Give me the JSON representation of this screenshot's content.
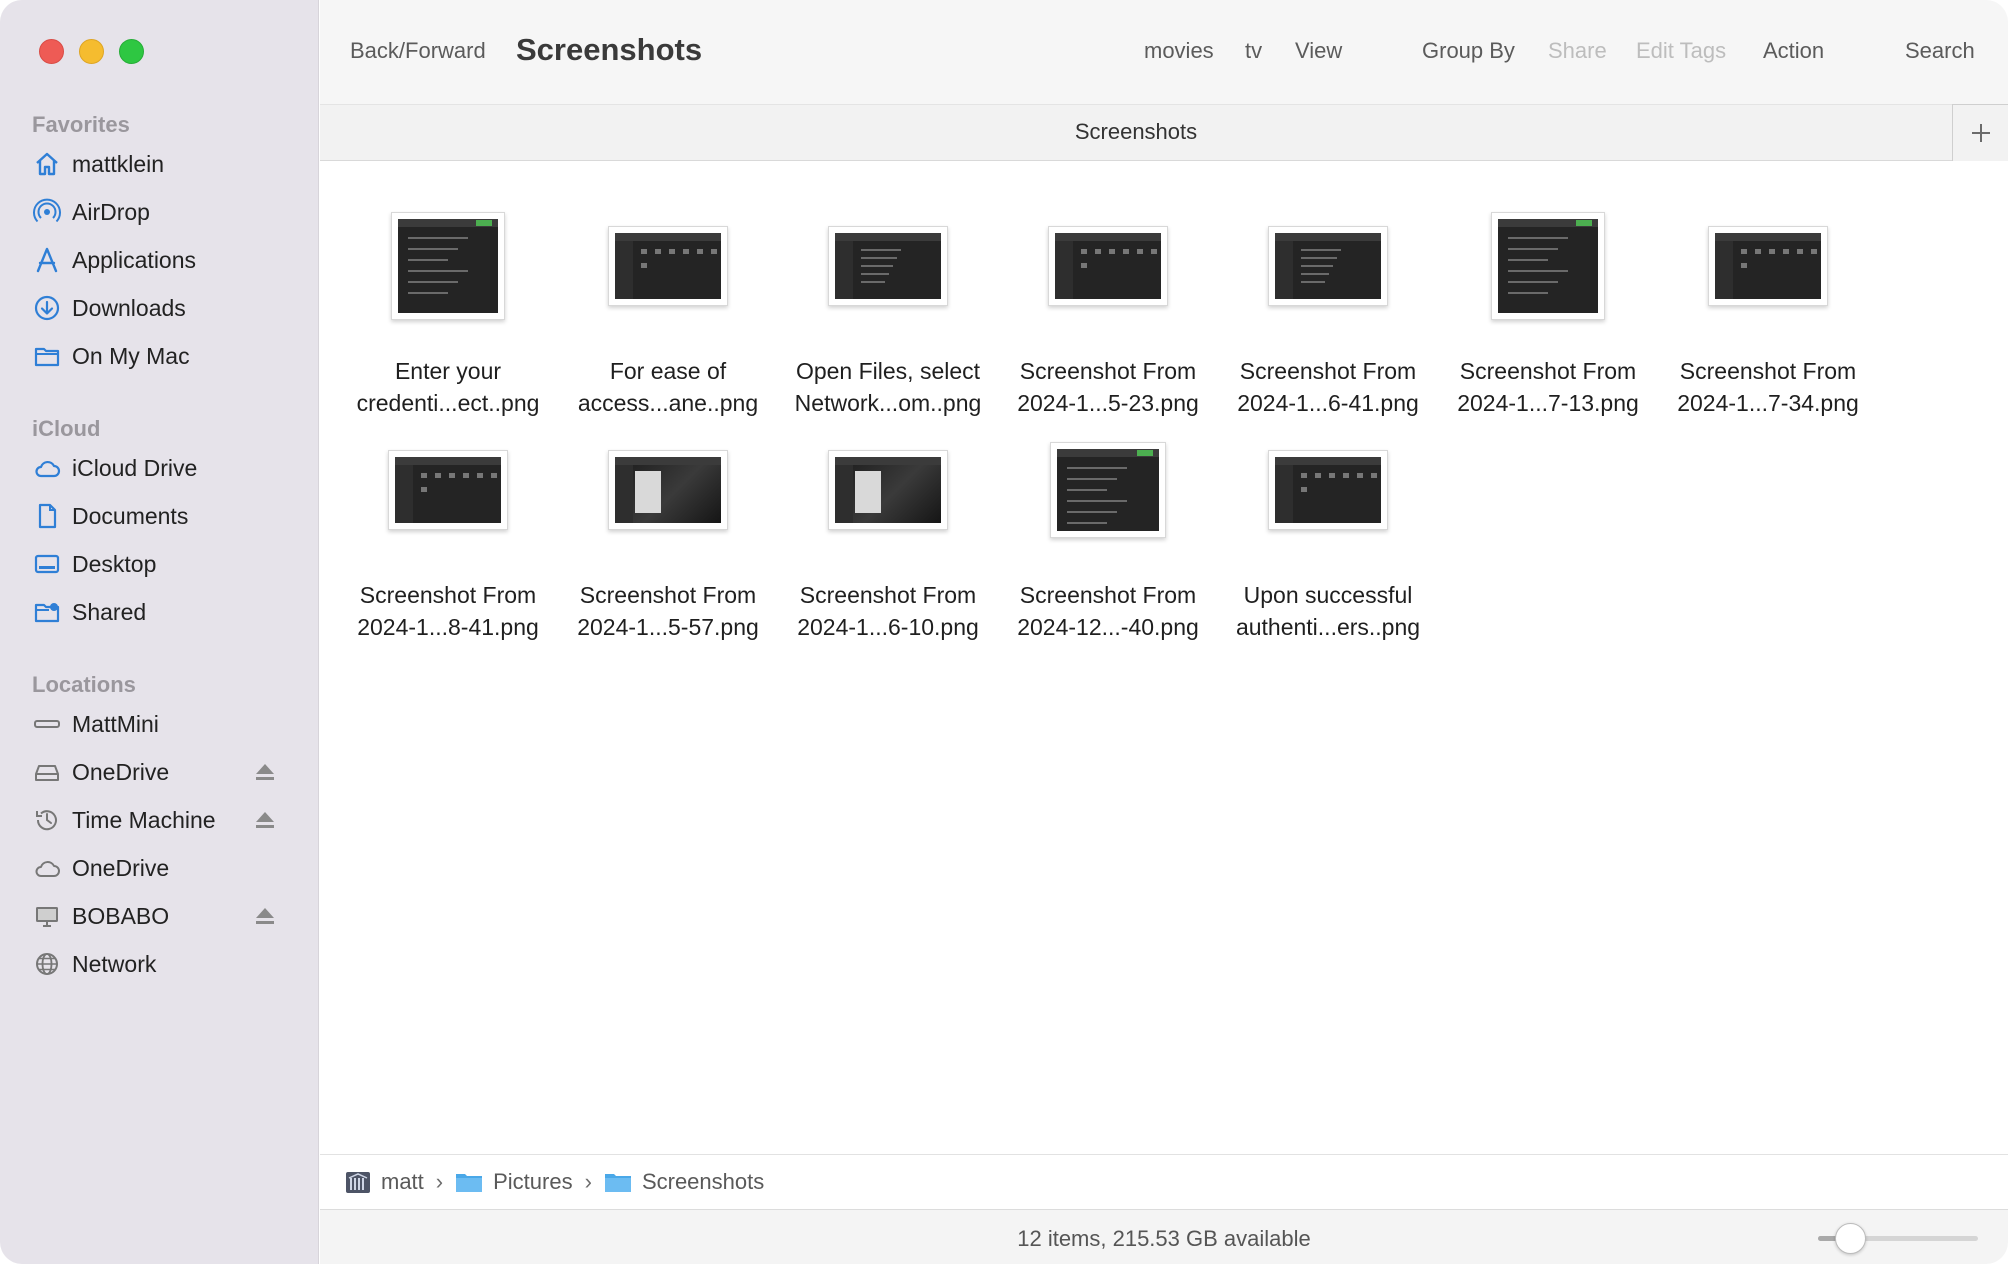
{
  "window": {
    "title": "Screenshots"
  },
  "toolbar": {
    "back_forward": "Back/Forward",
    "title": "Screenshots",
    "movies": "movies",
    "tv": "tv",
    "view": "View",
    "group_by": "Group By",
    "share": "Share",
    "edit_tags": "Edit Tags",
    "action": "Action",
    "search": "Search"
  },
  "tabbar": {
    "title": "Screenshots",
    "add_icon": "plus-icon"
  },
  "sidebar": {
    "favorites_heading": "Favorites",
    "favorites": [
      {
        "label": "mattklein",
        "icon": "home-icon"
      },
      {
        "label": "AirDrop",
        "icon": "airdrop-icon"
      },
      {
        "label": "Applications",
        "icon": "applications-icon"
      },
      {
        "label": "Downloads",
        "icon": "downloads-icon"
      },
      {
        "label": "On My Mac",
        "icon": "folder-icon"
      }
    ],
    "icloud_heading": "iCloud",
    "icloud": [
      {
        "label": "iCloud Drive",
        "icon": "cloud-icon"
      },
      {
        "label": "Documents",
        "icon": "document-icon"
      },
      {
        "label": "Desktop",
        "icon": "desktop-icon"
      },
      {
        "label": "Shared",
        "icon": "shared-folder-icon"
      }
    ],
    "locations_heading": "Locations",
    "locations": [
      {
        "label": "MattMini",
        "icon": "mac-mini-icon",
        "eject": false
      },
      {
        "label": "OneDrive",
        "icon": "drive-icon",
        "eject": true
      },
      {
        "label": "Time Machine",
        "icon": "time-machine-icon",
        "eject": true
      },
      {
        "label": "OneDrive",
        "icon": "cloud-icon",
        "eject": false
      },
      {
        "label": "BOBABO",
        "icon": "display-icon",
        "eject": true
      },
      {
        "label": "Network",
        "icon": "network-icon",
        "eject": false
      }
    ]
  },
  "files": [
    {
      "line1": "Enter your",
      "line2": "credenti...ect..png"
    },
    {
      "line1": "For ease of",
      "line2": "access...ane..png"
    },
    {
      "line1": "Open Files, select",
      "line2": "Network...om..png"
    },
    {
      "line1": "Screenshot From",
      "line2": "2024-1...5-23.png"
    },
    {
      "line1": "Screenshot From",
      "line2": "2024-1...6-41.png"
    },
    {
      "line1": "Screenshot From",
      "line2": "2024-1...7-13.png"
    },
    {
      "line1": "Screenshot From",
      "line2": "2024-1...7-34.png"
    },
    {
      "line1": "Screenshot From",
      "line2": "2024-1...8-41.png"
    },
    {
      "line1": "Screenshot From",
      "line2": "2024-1...5-57.png"
    },
    {
      "line1": "Screenshot From",
      "line2": "2024-1...6-10.png"
    },
    {
      "line1": "Screenshot From",
      "line2": "2024-12...-40.png"
    },
    {
      "line1": "Upon successful",
      "line2": "authenti...ers..png"
    }
  ],
  "pathbar": {
    "crumbs": [
      "matt",
      "Pictures",
      "Screenshots"
    ],
    "separator": "›"
  },
  "statusbar": {
    "text": "12 items, 215.53 GB available",
    "zoom_level": 0.2
  },
  "colors": {
    "accent": "#2f7fd6",
    "sidebar_bg": "#e6e3ea"
  }
}
